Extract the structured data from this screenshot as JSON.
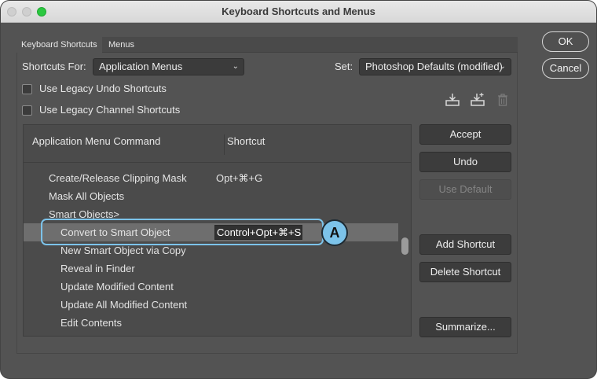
{
  "window": {
    "title": "Keyboard Shortcuts and Menus"
  },
  "tabs": [
    {
      "label": "Keyboard Shortcuts"
    },
    {
      "label": "Menus"
    }
  ],
  "shortcuts_for": {
    "label": "Shortcuts For:",
    "value": "Application Menus"
  },
  "set": {
    "label": "Set:",
    "value": "Photoshop Defaults (modified)"
  },
  "checkboxes": [
    {
      "label": "Use Legacy Undo Shortcuts",
      "checked": false
    },
    {
      "label": "Use Legacy Channel Shortcuts",
      "checked": false
    }
  ],
  "icons": [
    "save-set-icon",
    "save-set-as-icon",
    "delete-set-icon"
  ],
  "table": {
    "headers": [
      "Application Menu Command",
      "Shortcut"
    ],
    "rows": [
      {
        "command": "Create/Release Clipping Mask",
        "shortcut": "Opt+⌘+G"
      },
      {
        "command": "Mask All Objects",
        "shortcut": ""
      },
      {
        "command": "Smart Objects>",
        "shortcut": ""
      },
      {
        "command": "Convert to Smart Object",
        "shortcut": "Control+Opt+⌘+S"
      },
      {
        "command": "New Smart Object via Copy",
        "shortcut": ""
      },
      {
        "command": "Reveal in Finder",
        "shortcut": ""
      },
      {
        "command": "Update Modified Content",
        "shortcut": ""
      },
      {
        "command": "Update All Modified Content",
        "shortcut": ""
      },
      {
        "command": "Edit Contents",
        "shortcut": ""
      }
    ]
  },
  "callout": {
    "label": "A",
    "color": "#7cc3ea"
  },
  "buttons": {
    "accept": "Accept",
    "undo": "Undo",
    "use_default": "Use Default",
    "add_shortcut": "Add Shortcut",
    "delete_shortcut": "Delete Shortcut",
    "summarize": "Summarize...",
    "ok": "OK",
    "cancel": "Cancel"
  },
  "colors": {
    "panel_bg": "#535353",
    "selected_row": "#6e6e6e",
    "accent": "#7cc3ea"
  }
}
